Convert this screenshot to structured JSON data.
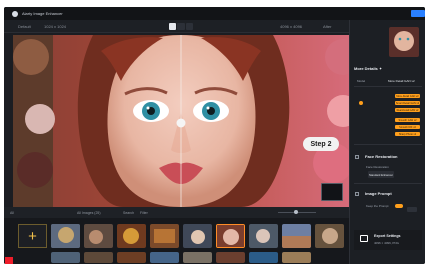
{
  "app": {
    "title": "Aiarty Image Enhancer",
    "accent": "#2a80ff",
    "warning_color": "#ff9f1c"
  },
  "subbar": {
    "left_label_1": "Default",
    "left_label_2": "1024 x 1024",
    "right_label_1": "4096 x 4096",
    "right_label_2": "After"
  },
  "preview": {
    "step_label": "Step 2"
  },
  "toolbar": {
    "items": [
      "All",
      "All Images (25)",
      "Search",
      "Filter"
    ]
  },
  "right_panel": {
    "section_1": "More Details ✦",
    "section_1_model_label": "Model",
    "section_1_model_value": "More Detail GAN v2",
    "chips": [
      "More-Detail GAN v2",
      "Smart Detail GAN v2",
      "Real-Detail GAN v2",
      "Smooth GAN v2",
      "Smooth DIF v2",
      "Sharp Photo v2"
    ],
    "section_2": "Face Restoration",
    "section_2_option": "Face Restoration",
    "section_2_mode": "Standard Enhancer",
    "section_3": "Image Prompt",
    "section_3_toggle": "Keep the Prompt",
    "section_4": "Export Settings",
    "section_4_value": "4096 × 4096, PNG"
  },
  "icons": {
    "title_logo": "app-logo-icon",
    "add_button": "plus-icon",
    "export": "export-icon"
  }
}
